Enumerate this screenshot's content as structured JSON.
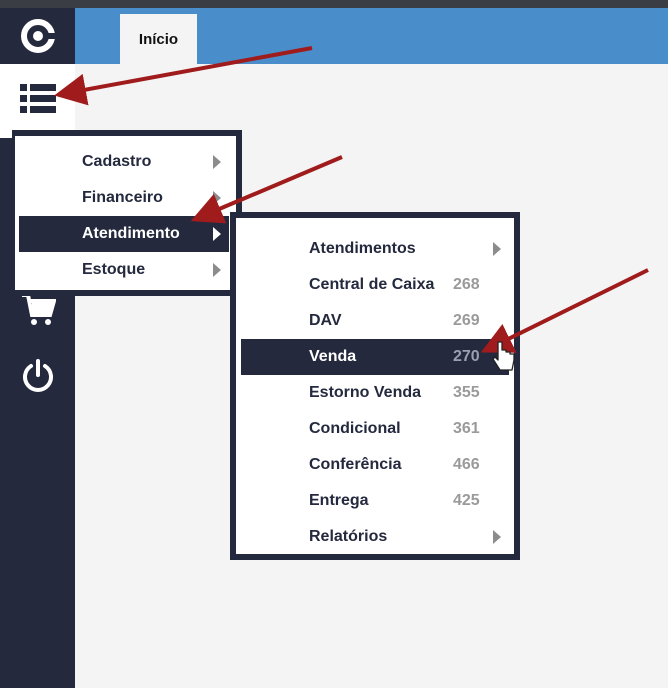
{
  "header": {
    "tab_label": "Início"
  },
  "sidebar": {
    "logo_icon": "logo-icon",
    "menu_icon": "list-menu-icon",
    "cart_icon": "shopping-cart-icon",
    "power_icon": "power-icon"
  },
  "menu_level1": {
    "items": [
      {
        "label": "Cadastro"
      },
      {
        "label": "Financeiro"
      },
      {
        "label": "Atendimento"
      },
      {
        "label": "Estoque"
      }
    ]
  },
  "menu_level2": {
    "items": [
      {
        "label": "Atendimentos",
        "code": ""
      },
      {
        "label": "Central de Caixa",
        "code": "268"
      },
      {
        "label": "DAV",
        "code": "269"
      },
      {
        "label": "Venda",
        "code": "270"
      },
      {
        "label": "Estorno Venda",
        "code": "355"
      },
      {
        "label": "Condicional",
        "code": "361"
      },
      {
        "label": "Conferência",
        "code": "466"
      },
      {
        "label": "Entrega",
        "code": "425"
      },
      {
        "label": "Relatórios",
        "code": ""
      }
    ]
  },
  "colors": {
    "sidebar": "#24293e",
    "header": "#4a8dcb",
    "annotation_arrow": "#a01c1c"
  }
}
